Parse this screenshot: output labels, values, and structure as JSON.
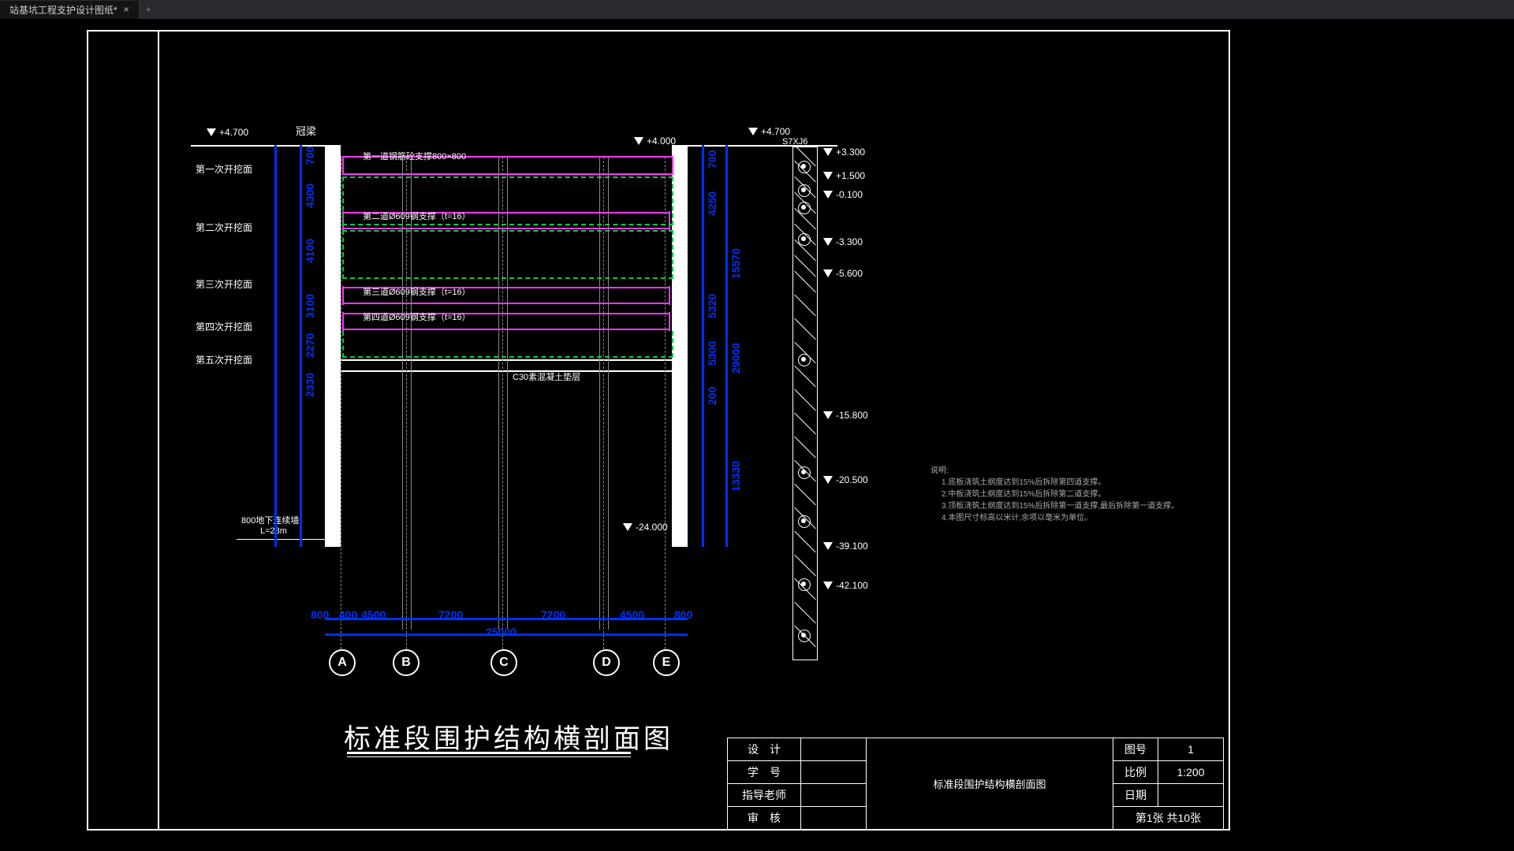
{
  "ui": {
    "tab_title": "站基坑工程支护设计图纸*",
    "tab_plus": "+"
  },
  "labels": {
    "crown_beam": "冠梁",
    "excavation": [
      "第一次开挖面",
      "第二次开挖面",
      "第三次开挖面",
      "第四次开挖面",
      "第五次开挖面"
    ],
    "strut1": "第一道钢筋砼支撑800×800",
    "strut2": "第二道Ø609钢支撑（t=16）",
    "strut3": "第三道Ø609钢支撑（t=16）",
    "strut4": "第四道Ø609钢支撑（t=16）",
    "c30": "C30素混凝土垫层",
    "dwall": "800地下连续墙",
    "dwall_len": "L=28m",
    "borehole": "S7XJ6"
  },
  "elevations": {
    "top_left": "+4.700",
    "top_right": "+4.000",
    "top_right2": "+4.700",
    "bottom": "-24.000",
    "soil": [
      "+3.300",
      "+1.500",
      "-0.100",
      "-3.300",
      "-5.600",
      "-15.800",
      "-20.500",
      "-39.100",
      "-42.100"
    ]
  },
  "vertical_dims_left": [
    "700",
    "4300",
    "4100",
    "3100",
    "2270",
    "2330"
  ],
  "vertical_dims_right": [
    "700",
    "4250",
    "15570",
    "5320",
    "5300",
    "200",
    "29000",
    "13330"
  ],
  "h_dims": [
    "800",
    "4500",
    "7200",
    "7200",
    "4500",
    "800",
    "400",
    "25000"
  ],
  "axes": [
    "A",
    "B",
    "C",
    "D",
    "E"
  ],
  "title": "标准段围护结构横剖面图",
  "notes_header": "说明:",
  "notes": [
    "1.底板浇筑土纲度达到15%后拆除第四道支撑。",
    "2.中板浇筑土纲度达到15%后拆除第二道支撑。",
    "3.顶板浇筑土纲度达到15%后拆除第一道支撑,最后拆除第一道支撑。",
    "4.本图尺寸标高以米计,余项以毫米为单位。"
  ],
  "titleblock": {
    "rows": [
      "设　计",
      "学　号",
      "指导老师",
      "审　核"
    ],
    "center": "标准段围护结构横剖面图",
    "right_labels": [
      "图号",
      "比例",
      "日期"
    ],
    "right_vals": [
      "1",
      "1:200",
      ""
    ],
    "sheet": "第1张 共10张"
  }
}
